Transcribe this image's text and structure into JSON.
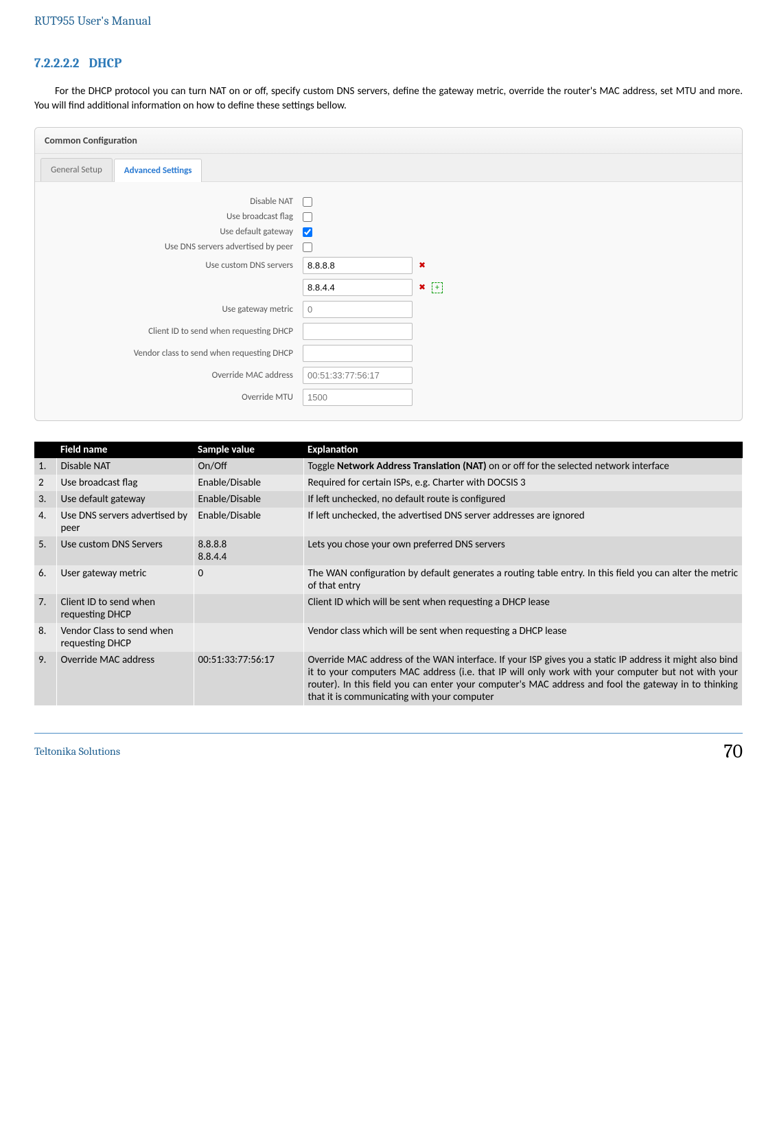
{
  "header": {
    "title": "RUT955 User's Manual"
  },
  "section": {
    "number": "7.2.2.2.2",
    "title": "DHCP"
  },
  "intro": "For the DHCP protocol you can turn NAT on or off, specify custom DNS servers, define the gateway metric, override the router's MAC address, set MTU and more. You will find additional information on how to define these settings bellow.",
  "panel": {
    "title": "Common Configuration",
    "tabs": {
      "general": "General Setup",
      "advanced": "Advanced Settings"
    },
    "fields": {
      "disable_nat": {
        "label": "Disable NAT"
      },
      "broadcast": {
        "label": "Use broadcast flag"
      },
      "default_gw": {
        "label": "Use default gateway"
      },
      "dns_peer": {
        "label": "Use DNS servers advertised by peer"
      },
      "custom_dns": {
        "label": "Use custom DNS servers",
        "val1": "8.8.8.8",
        "val2": "8.8.4.4"
      },
      "gw_metric": {
        "label": "Use gateway metric",
        "placeholder": "0"
      },
      "client_id": {
        "label": "Client ID to send when requesting DHCP"
      },
      "vendor_class": {
        "label": "Vendor class to send when requesting DHCP"
      },
      "override_mac": {
        "label": "Override MAC address",
        "placeholder": "00:51:33:77:56:17"
      },
      "override_mtu": {
        "label": "Override MTU",
        "placeholder": "1500"
      }
    }
  },
  "table": {
    "headers": {
      "blank": "",
      "field": "Field name",
      "sample": "Sample value",
      "explanation": "Explanation"
    },
    "rows": [
      {
        "n": "1.",
        "field": "Disable NAT",
        "sample": "On/Off",
        "explanation_html": "Toggle <b>Network Address Translation (NAT)</b> on or off for the selected network interface"
      },
      {
        "n": "2",
        "field": "Use broadcast flag",
        "sample": "Enable/Disable",
        "explanation": "Required for certain ISPs, e.g. Charter with DOCSIS 3"
      },
      {
        "n": "3.",
        "field": "Use default gateway",
        "sample": "Enable/Disable",
        "explanation": "If left unchecked, no default route is configured"
      },
      {
        "n": "4.",
        "field": "Use DNS servers advertised by peer",
        "sample": "Enable/Disable",
        "explanation": "If left unchecked, the advertised DNS server addresses are ignored"
      },
      {
        "n": "5.",
        "field": "Use custom DNS Servers",
        "sample": "8.8.8.8\n8.8.4.4",
        "explanation": "Lets you chose your own preferred DNS servers"
      },
      {
        "n": "6.",
        "field": "User gateway metric",
        "sample": "0",
        "explanation": "The WAN configuration by default generates a routing table entry. In this field you can alter the metric of that entry"
      },
      {
        "n": "7.",
        "field": "Client ID to send when requesting DHCP",
        "sample": "",
        "explanation": "Client ID which will be sent when requesting a DHCP lease"
      },
      {
        "n": "8.",
        "field": "Vendor Class to send when requesting DHCP",
        "sample": "",
        "explanation": "Vendor class which will be sent when requesting a DHCP lease"
      },
      {
        "n": "9.",
        "field": "Override MAC address",
        "sample": "00:51:33:77:56:17",
        "explanation": "Override MAC address of the WAN interface. If your ISP gives you a static IP address it might also bind it to your computers MAC address (i.e. that IP will only work with your computer but not with your router). In this field you can enter your computer's MAC address and fool the gateway in to thinking that it is communicating with your computer"
      }
    ]
  },
  "footer": {
    "left": "Teltonika Solutions",
    "page": "70"
  }
}
